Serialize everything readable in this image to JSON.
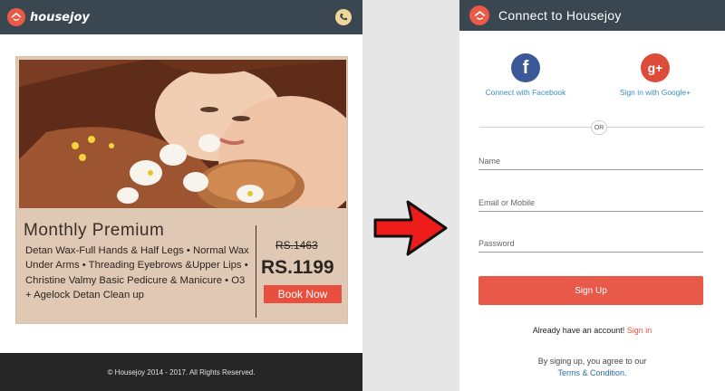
{
  "left": {
    "brand": "housejoy",
    "card": {
      "title": "Monthly Premium",
      "description": "Detan Wax-Full Hands & Half Legs • Normal Wax Under Arms • Threading Eyebrows &Upper Lips • Christine Valmy Basic Pedicure & Manicure • O3 + Agelock Detan Clean up",
      "old_price": "RS.1463",
      "new_price": "RS.1199",
      "cta": "Book Now"
    },
    "footer": "© Housejoy 2014 - 2017. All Rights Reserved."
  },
  "right": {
    "title": "Connect to Housejoy",
    "facebook": {
      "icon": "f",
      "label": "Connect with Facebook"
    },
    "google": {
      "icon": "g+",
      "label": "Sign in with Google+"
    },
    "or_text": "OR",
    "fields": {
      "name_placeholder": "Name",
      "email_placeholder": "Email or Mobile",
      "password_placeholder": "Password"
    },
    "signup_label": "Sign Up",
    "already_text": "Already have an account!",
    "signin_link": "Sign in",
    "terms_text": "By siging up, you agree to our",
    "terms_link": "Terms & Condition."
  },
  "colors": {
    "header": "#3b4750",
    "accent": "#e84f3f",
    "facebook": "#3b5998",
    "google": "#dd4b39",
    "card_bg": "#dfc9b5"
  }
}
